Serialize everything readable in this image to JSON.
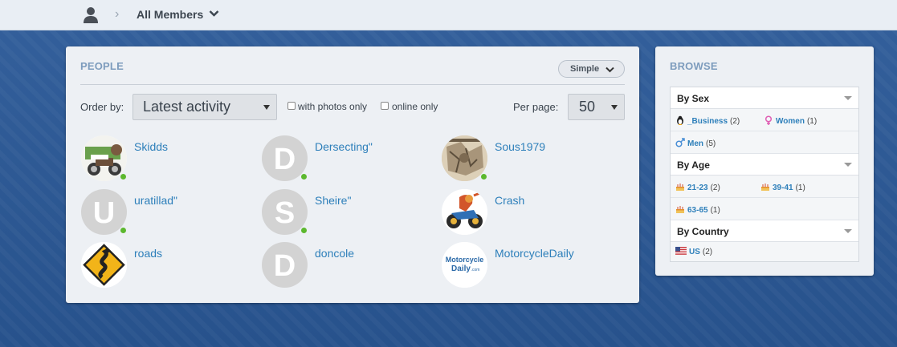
{
  "breadcrumb": {
    "title": "All Members"
  },
  "people": {
    "heading": "PEOPLE",
    "view_mode": "Simple",
    "order_label": "Order by:",
    "order_value": "Latest activity",
    "filter_photos": "with photos only",
    "filter_online": "online only",
    "per_page_label": "Per page:",
    "per_page_value": "50",
    "members": [
      {
        "name": "Skidds",
        "avatar": "photo-bike-cartoon",
        "online": true
      },
      {
        "name": "Dersecting\"",
        "avatar_letter": "D",
        "online": true
      },
      {
        "name": "Sous1979",
        "avatar": "photo-engraving",
        "online": true
      },
      {
        "name": "uratillad\"",
        "avatar_letter": "U",
        "online": true
      },
      {
        "name": "Sheire\"",
        "avatar_letter": "S",
        "online": true
      },
      {
        "name": "Crash",
        "avatar": "photo-motorcycle-cartoon",
        "online": false
      },
      {
        "name": "roads",
        "avatar": "photo-road-sign",
        "online": false
      },
      {
        "name": "doncole",
        "avatar_letter": "D",
        "online": false
      },
      {
        "name": "MotorcycleDaily",
        "avatar": "logo-motorcycle-daily",
        "avatar_text_1": "Motorcycle",
        "avatar_text_2": "Daily",
        "avatar_text_3": ".com",
        "online": false
      }
    ]
  },
  "browse": {
    "heading": "BROWSE",
    "sections": [
      {
        "title": "By Sex",
        "items": [
          {
            "label": "_Business",
            "count": "(2)",
            "icon": "penguin-icon"
          },
          {
            "label": "Women",
            "count": "(1)",
            "icon": "female-icon"
          },
          {
            "label": "Men",
            "count": "(5)",
            "icon": "male-icon"
          }
        ]
      },
      {
        "title": "By Age",
        "items": [
          {
            "label": "21-23",
            "count": "(2)",
            "icon": "cake-icon"
          },
          {
            "label": "39-41",
            "count": "(1)",
            "icon": "cake-icon"
          },
          {
            "label": "63-65",
            "count": "(1)",
            "icon": "cake-icon"
          }
        ]
      },
      {
        "title": "By Country",
        "items": [
          {
            "label": "US",
            "count": "(2)",
            "icon": "us-flag-icon"
          }
        ]
      }
    ]
  },
  "colors": {
    "link": "#2d7fba",
    "online": "#5cb82e",
    "heading": "#7d9cbd"
  }
}
